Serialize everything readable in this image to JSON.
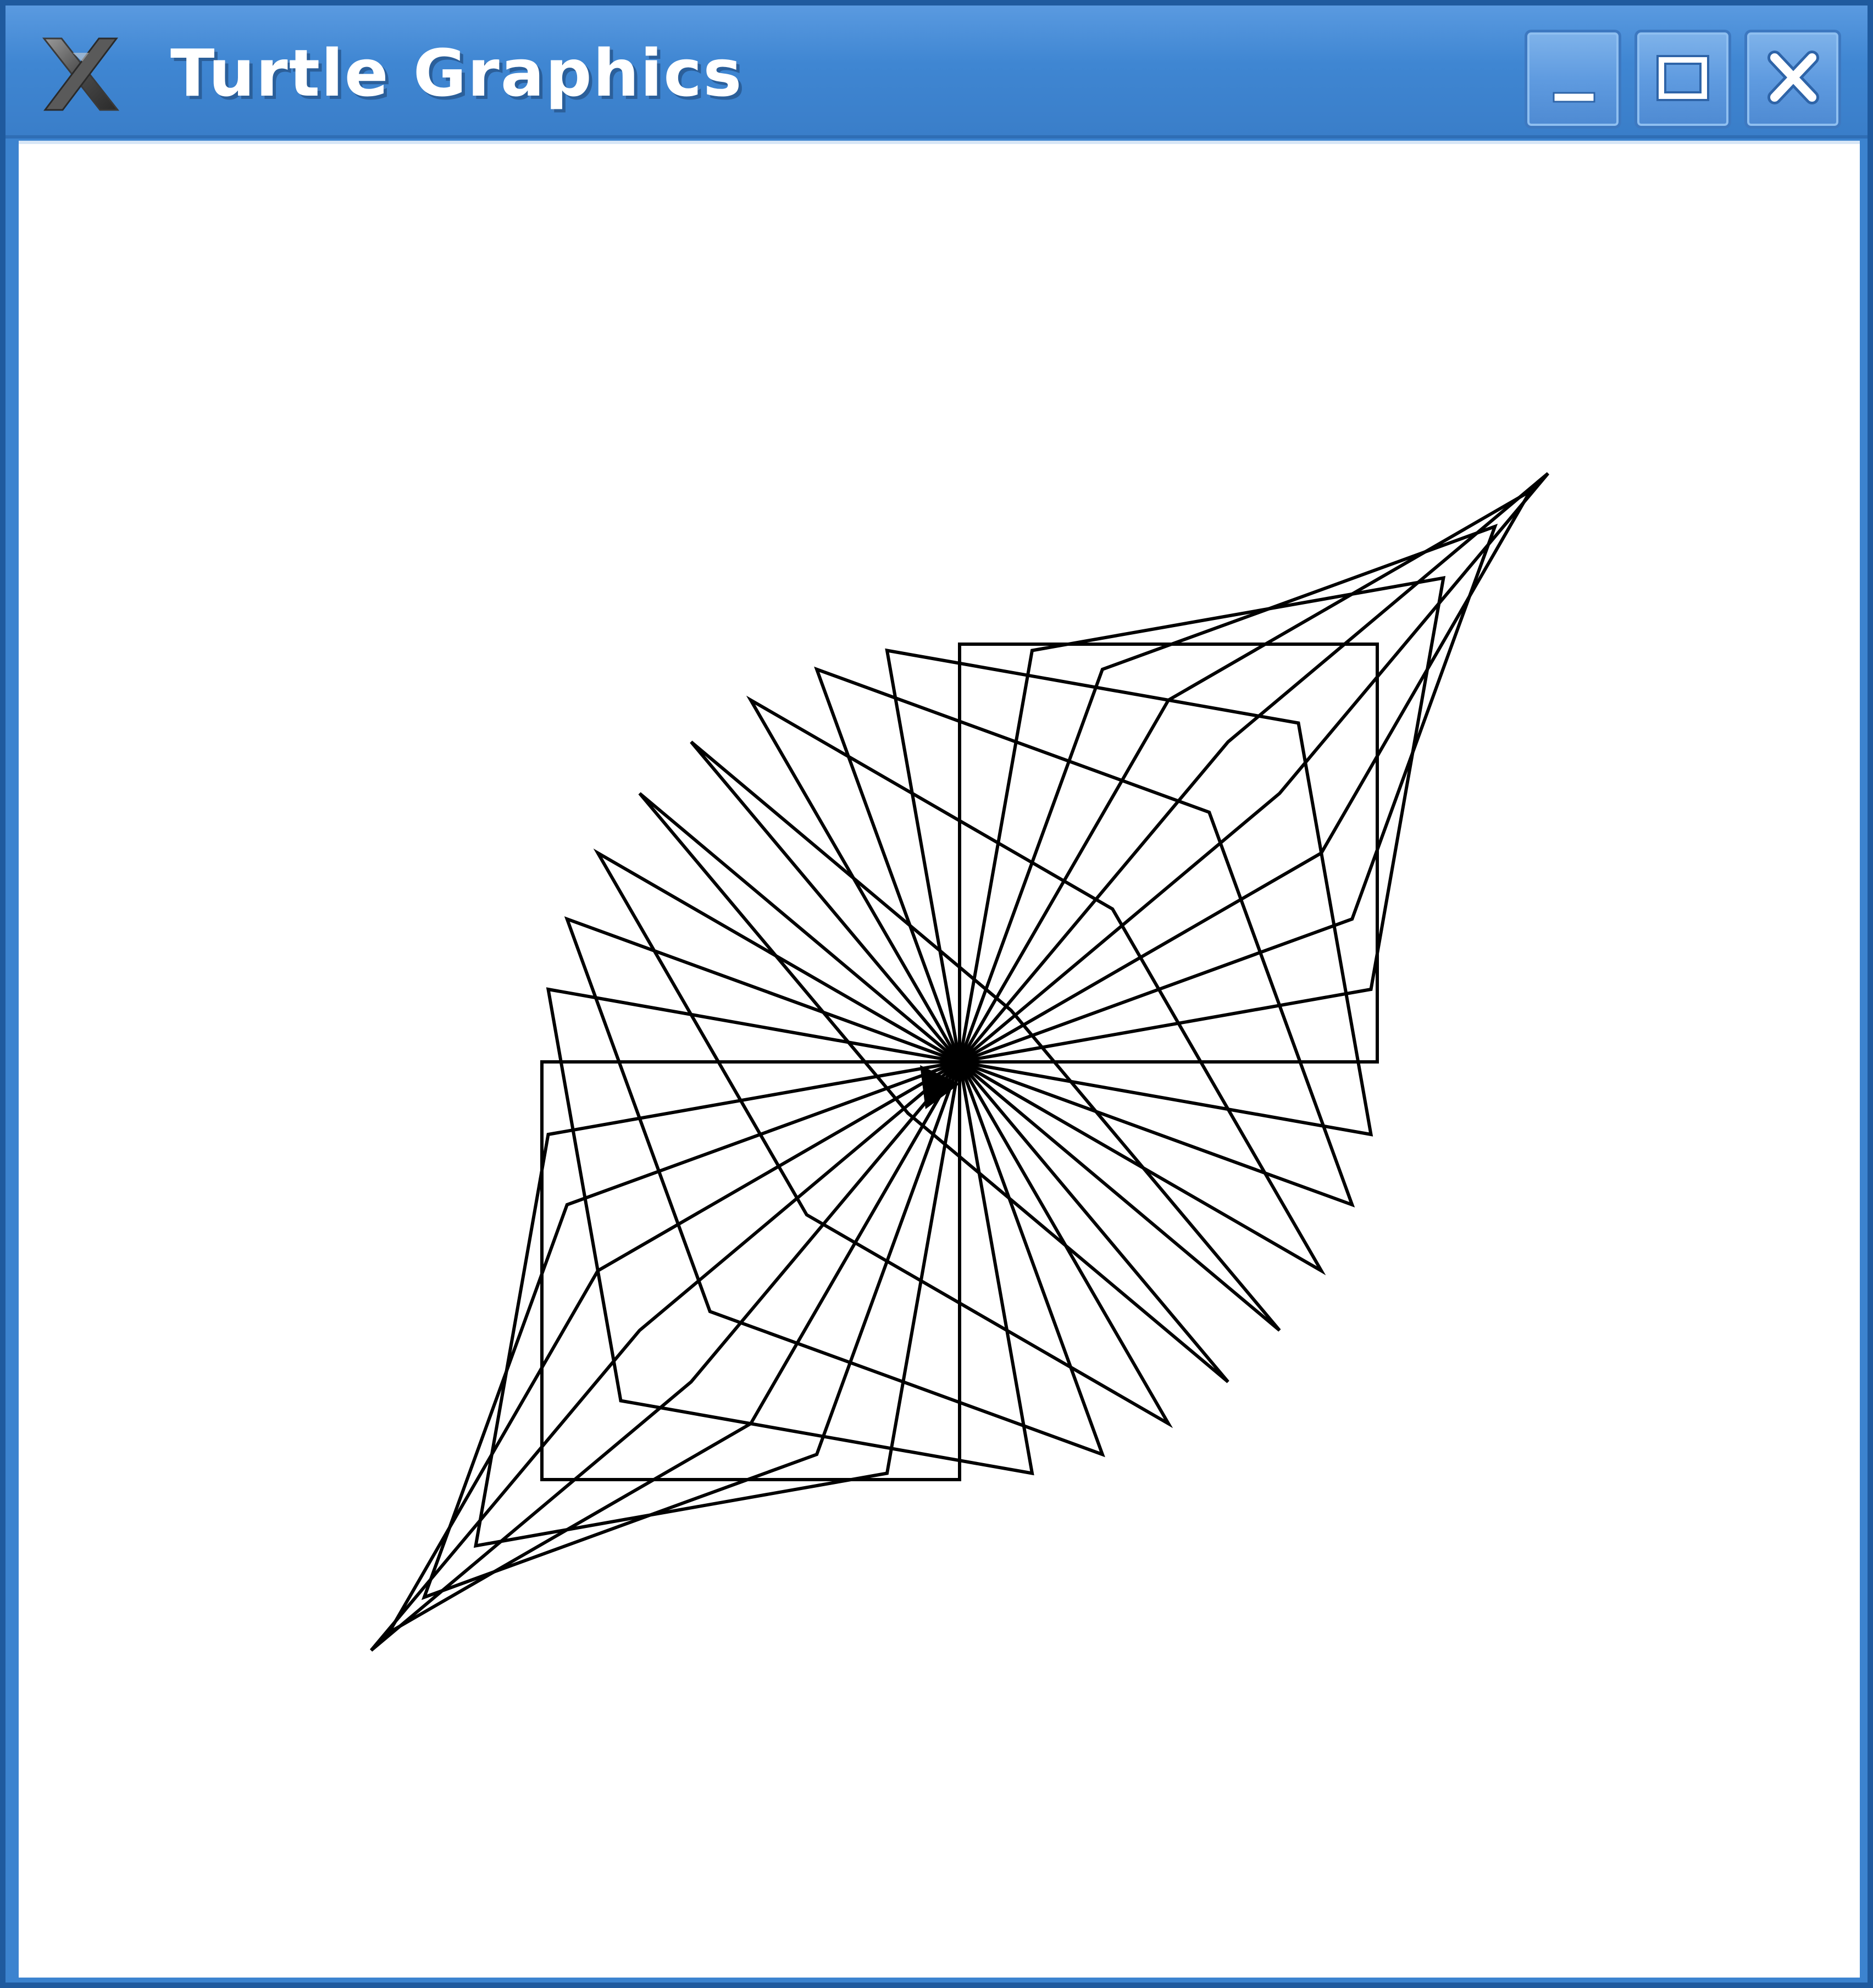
{
  "window": {
    "title": "Turtle Graphics",
    "app_icon": "x-window-system-icon",
    "controls": [
      {
        "name": "minimize-button",
        "icon": "minimize-icon"
      },
      {
        "name": "maximize-button",
        "icon": "maximize-icon"
      },
      {
        "name": "close-button",
        "icon": "close-icon"
      }
    ]
  },
  "drawing": {
    "pen_color": "#000000",
    "background": "#ffffff",
    "repetitions": 18,
    "turn_degrees": 20,
    "shape": "square",
    "cursor": "turtle-arrow"
  }
}
